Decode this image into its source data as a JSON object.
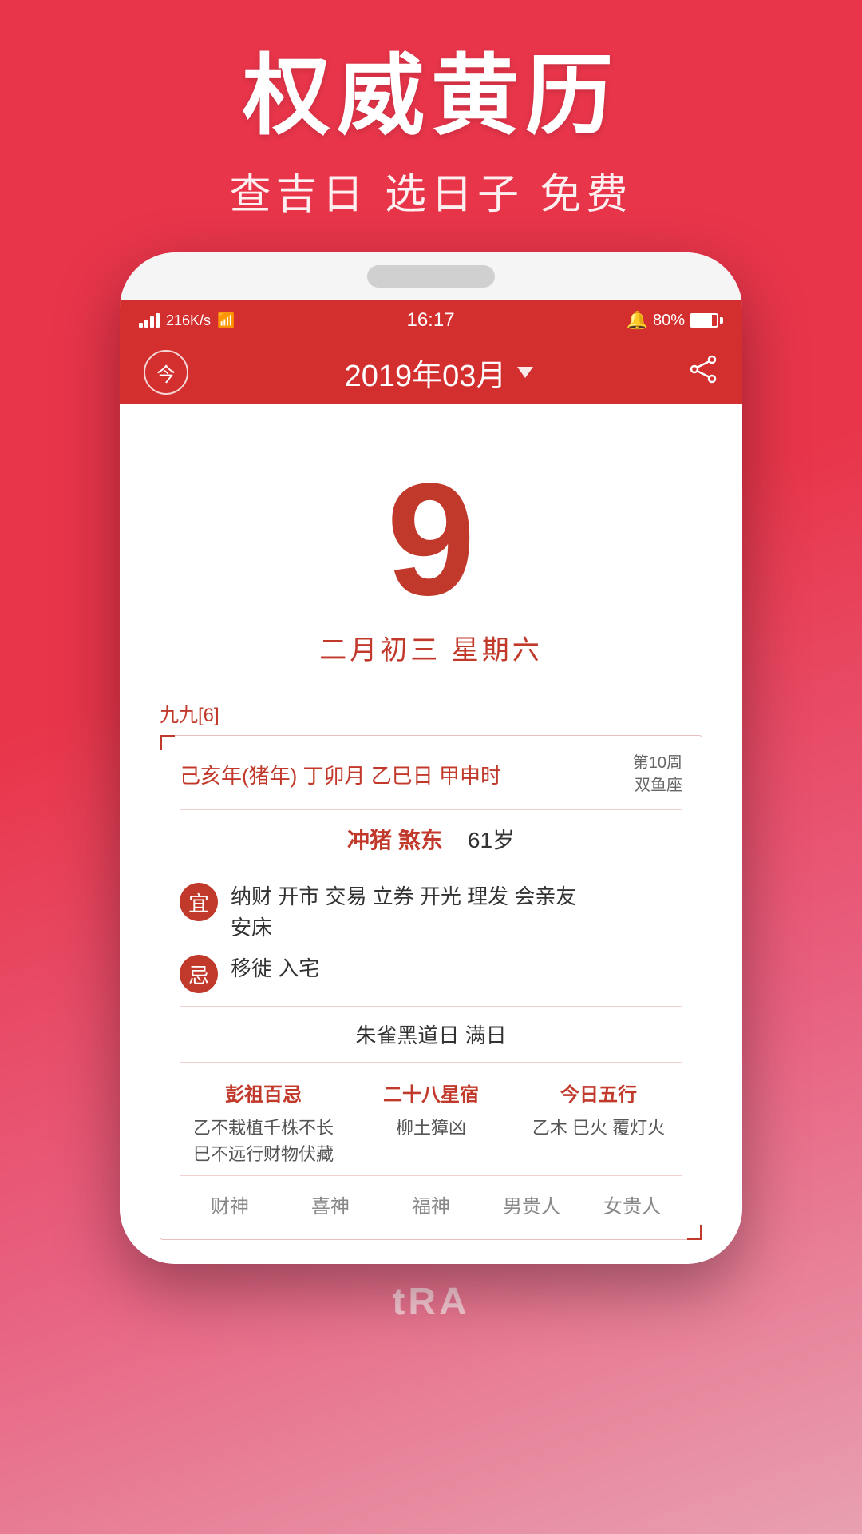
{
  "promo": {
    "title": "权威黄历",
    "subtitle": "查吉日 选日子 免费"
  },
  "status_bar": {
    "left": "4G  216K/s  WiFi",
    "time": "16:17",
    "battery": "80%"
  },
  "header": {
    "today_label": "今",
    "month_title": "2019年03月",
    "has_dropdown": true
  },
  "calendar": {
    "day": "9",
    "lunar": "二月初三  星期六",
    "jiu": "九九[6]",
    "ganzhi": "己亥年(猪年) 丁卯月 乙巳日 甲申时",
    "week": "第10周",
    "zodiac": "双鱼座",
    "chong": "冲猪  煞东",
    "age": "61岁",
    "yi_badge": "宜",
    "yi_text": "纳财 开市 交易 立券 开光 理发 会亲友\n安床",
    "ji_badge": "忌",
    "ji_text": "移徙 入宅",
    "black_day": "朱雀黑道日  满日",
    "pengzu_title": "彭祖百忌",
    "pengzu_content": "乙不栽植千株不长\n巳不远行财物伏藏",
    "star_title": "二十八星宿",
    "star_content": "柳土獐凶",
    "wuxing_title": "今日五行",
    "wuxing_content": "乙木 巳火 覆灯火",
    "footer_labels": [
      "财神",
      "喜神",
      "福神",
      "男贵人",
      "女贵人"
    ]
  },
  "bottom": {
    "tra": "tRA"
  }
}
